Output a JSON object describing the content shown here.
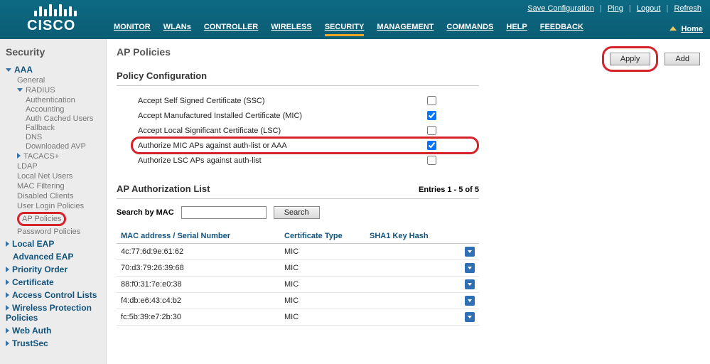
{
  "toplinks": {
    "save": "Save Configuration",
    "ping": "Ping",
    "logout": "Logout",
    "refresh": "Refresh",
    "home": "Home"
  },
  "brand": "CISCO",
  "nav": {
    "monitor": "MONITOR",
    "wlans": "WLANs",
    "controller": "CONTROLLER",
    "wireless": "WIRELESS",
    "security": "SECURITY",
    "management": "MANAGEMENT",
    "commands": "COMMANDS",
    "help": "HELP",
    "feedback": "FEEDBACK"
  },
  "sidebar": {
    "title": "Security",
    "aaa": "AAA",
    "general": "General",
    "radius": "RADIUS",
    "authentication": "Authentication",
    "accounting": "Accounting",
    "auth_cached": "Auth Cached Users",
    "fallback": "Fallback",
    "dns": "DNS",
    "dl_avp": "Downloaded AVP",
    "tacacs": "TACACS+",
    "ldap": "LDAP",
    "local_net": "Local Net Users",
    "mac_filter": "MAC Filtering",
    "disabled": "Disabled Clients",
    "user_login": "User Login Policies",
    "ap_policies": "AP Policies",
    "password_policies": "Password Policies",
    "local_eap": "Local EAP",
    "advanced_eap": "Advanced EAP",
    "priority": "Priority Order",
    "certificate": "Certificate",
    "acl": "Access Control Lists",
    "wpp": "Wireless Protection Policies",
    "webauth": "Web Auth",
    "trustsec": "TrustSec"
  },
  "page": {
    "title": "AP Policies",
    "apply": "Apply",
    "add": "Add"
  },
  "policy": {
    "section": "Policy Configuration",
    "ssc": "Accept Self Signed Certificate (SSC)",
    "mic": "Accept Manufactured Installed Certificate (MIC)",
    "lsc": "Accept Local Significant Certificate (LSC)",
    "auth_mic": "Authorize MIC APs against auth-list or AAA",
    "auth_lsc": "Authorize LSC APs against auth-list"
  },
  "authlist": {
    "section": "AP Authorization List",
    "entries": "Entries 1 - 5 of 5",
    "search_label": "Search by MAC",
    "search_btn": "Search",
    "col_mac": "MAC address / Serial Number",
    "col_cert": "Certificate Type",
    "col_sha1": "SHA1 Key Hash",
    "rows": [
      {
        "mac": "4c:77:6d:9e:61:62",
        "cert": "MIC",
        "sha1": ""
      },
      {
        "mac": "70:d3:79:26:39:68",
        "cert": "MIC",
        "sha1": ""
      },
      {
        "mac": "88:f0:31:7e:e0:38",
        "cert": "MIC",
        "sha1": ""
      },
      {
        "mac": "f4:db:e6:43:c4:b2",
        "cert": "MIC",
        "sha1": ""
      },
      {
        "mac": "fc:5b:39:e7:2b:30",
        "cert": "MIC",
        "sha1": ""
      }
    ]
  }
}
